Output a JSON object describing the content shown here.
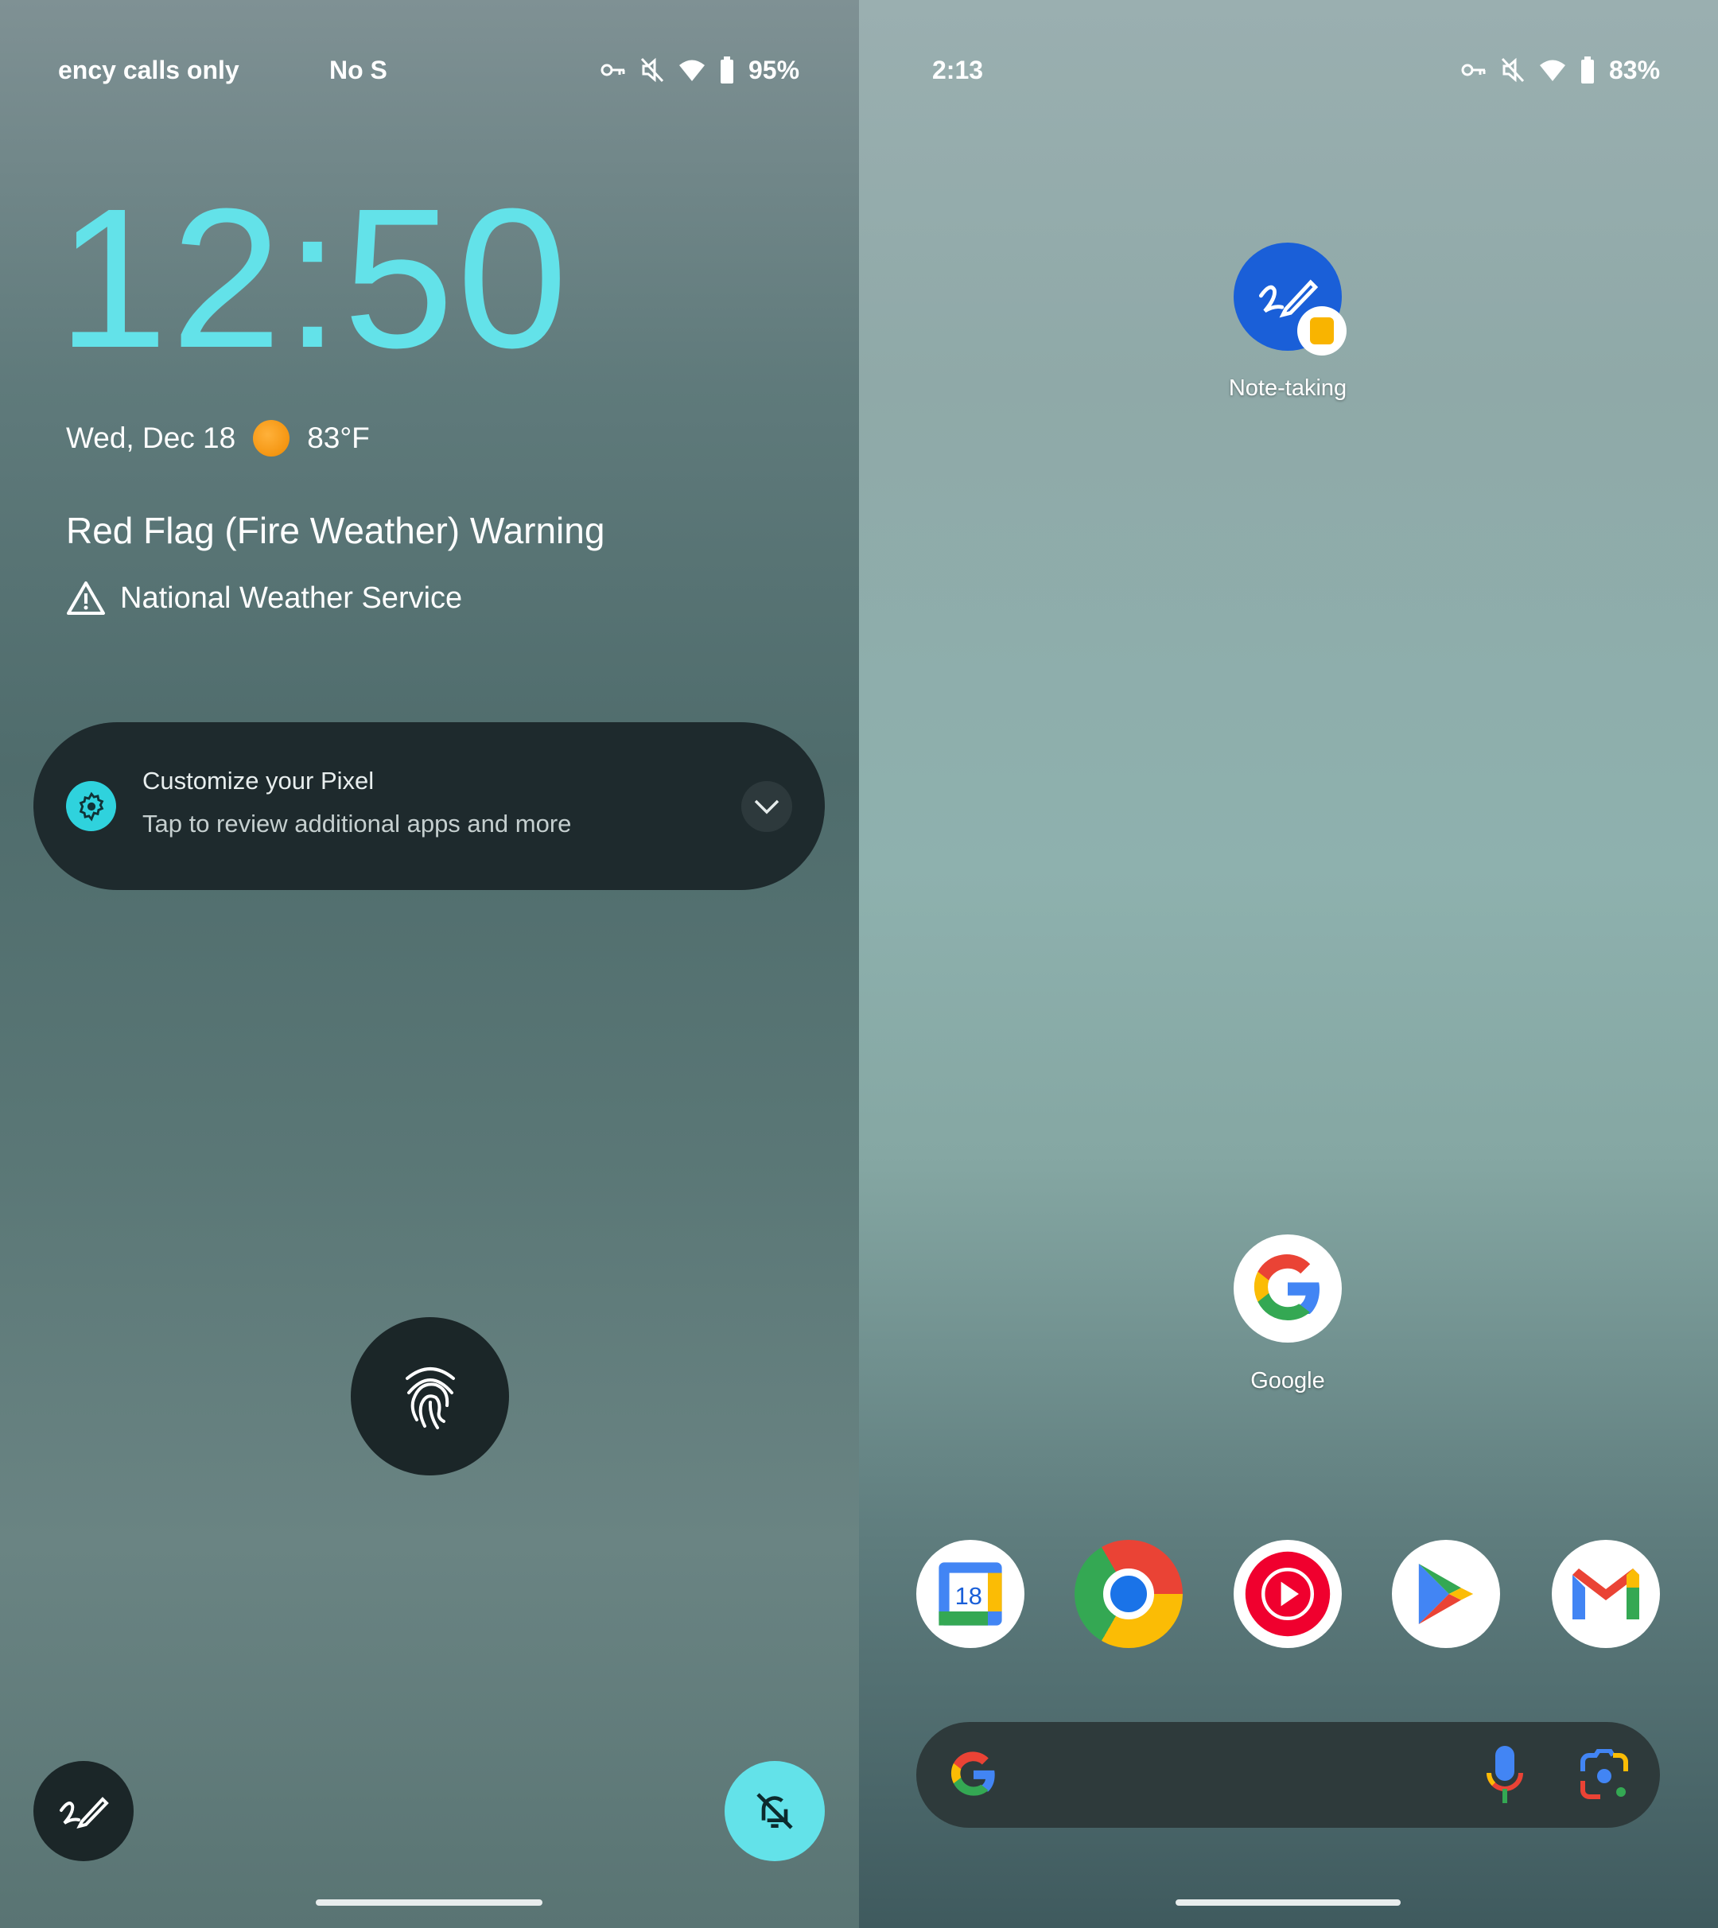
{
  "lock_screen": {
    "status_bar": {
      "carrier": "ency calls only",
      "sim": "No S",
      "battery": "95%",
      "icons": [
        "vpn-key-icon",
        "mute-icon",
        "wifi-icon",
        "battery-icon"
      ]
    },
    "clock": "12:50",
    "date": "Wed, Dec 18",
    "weather": {
      "icon": "sun-icon",
      "temp": "83°F"
    },
    "alert": {
      "title": "Red Flag (Fire Weather) Warning",
      "source": "National Weather Service",
      "icon": "warning-icon"
    },
    "notification": {
      "title": "Customize your Pixel",
      "text": "Tap to review additional apps and more",
      "icon": "gear-icon"
    },
    "shortcuts": {
      "left": "note-taking-icon",
      "right": "notifications-off-icon"
    },
    "accent": "#63e2e9"
  },
  "home_screen": {
    "status_bar": {
      "time": "2:13",
      "battery": "83%"
    },
    "apps": [
      {
        "label": "Note-taking"
      },
      {
        "label": "Google"
      }
    ],
    "dock": [
      "Calendar",
      "Chrome",
      "YouTube Music",
      "Play Store",
      "Gmail"
    ],
    "calendar_day": "18"
  }
}
